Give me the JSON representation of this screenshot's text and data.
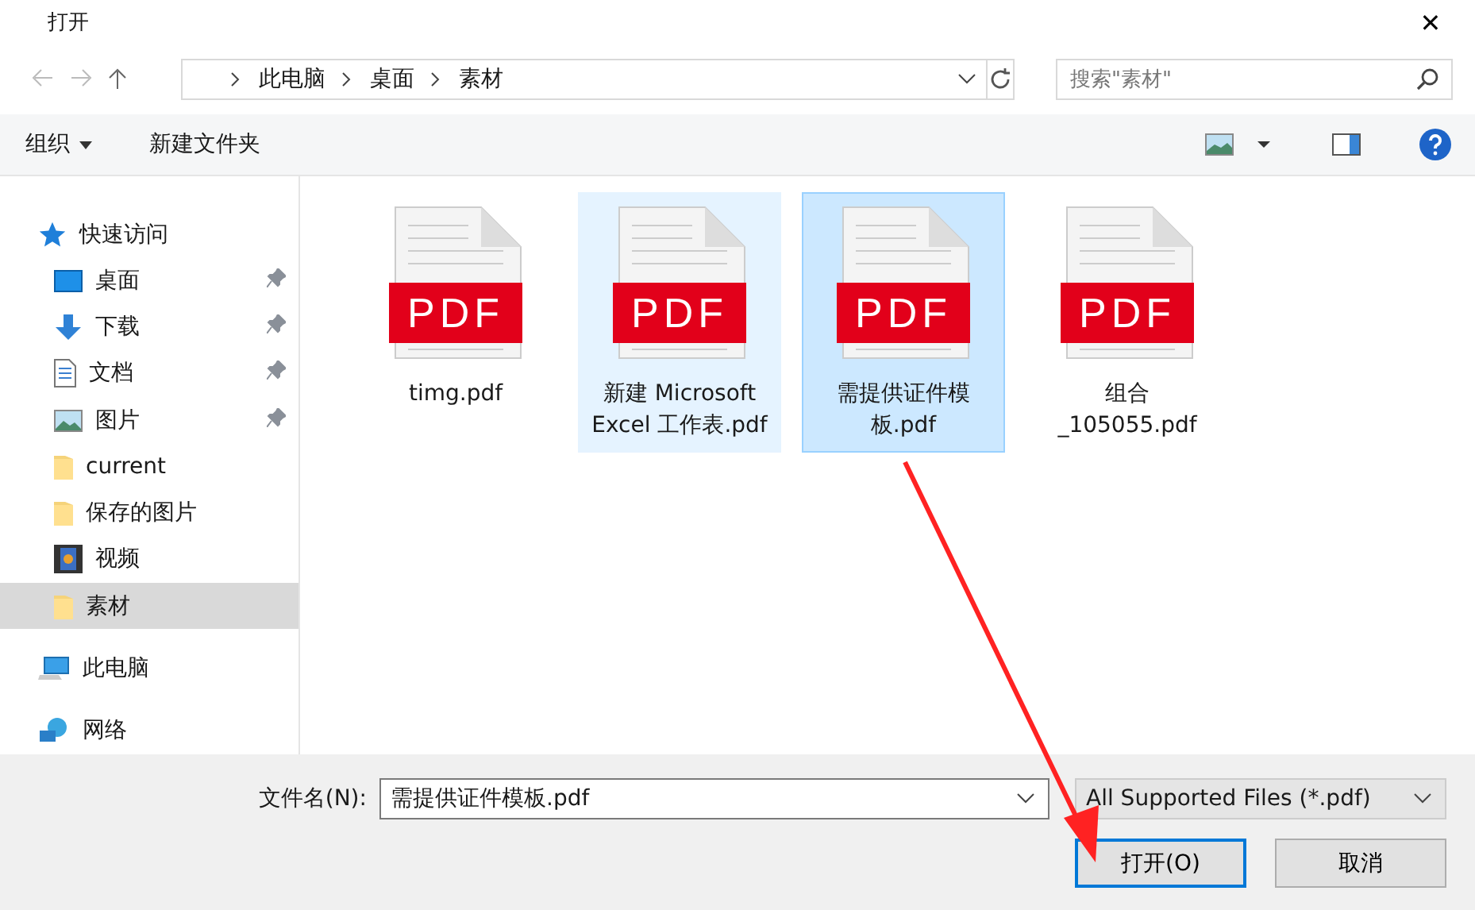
{
  "window": {
    "title": "打开",
    "close": "✕"
  },
  "address": {
    "segments": [
      "此电脑",
      "桌面",
      "素材"
    ],
    "search_placeholder": "搜索\"素材\""
  },
  "toolbar": {
    "organize": "组织",
    "new_folder": "新建文件夹"
  },
  "sidebar": {
    "items": [
      {
        "label": "快速访问",
        "kind": "star",
        "selected": false,
        "children": [
          {
            "label": "桌面",
            "kind": "desktop",
            "pinned": true,
            "selected": false
          },
          {
            "label": "下载",
            "kind": "download",
            "pinned": true,
            "selected": false
          },
          {
            "label": "文档",
            "kind": "document",
            "pinned": true,
            "selected": false
          },
          {
            "label": "图片",
            "kind": "pictures",
            "pinned": true,
            "selected": false
          },
          {
            "label": "current",
            "kind": "folder",
            "pinned": false,
            "selected": false
          },
          {
            "label": "保存的图片",
            "kind": "folder",
            "pinned": false,
            "selected": false
          },
          {
            "label": "视频",
            "kind": "video",
            "pinned": false,
            "selected": false
          },
          {
            "label": "素材",
            "kind": "folder",
            "pinned": false,
            "selected": true
          }
        ]
      },
      {
        "label": "此电脑",
        "kind": "computer",
        "selected": false
      },
      {
        "label": "网络",
        "kind": "network",
        "selected": false
      }
    ]
  },
  "files": [
    {
      "name": "timg.pdf",
      "badge": "PDF",
      "selected": false,
      "hovered": false
    },
    {
      "name": "新建 Microsoft Excel 工作表.pdf",
      "badge": "PDF",
      "selected": false,
      "hovered": true
    },
    {
      "name": "需提供证件模板.pdf",
      "badge": "PDF",
      "selected": true,
      "hovered": false
    },
    {
      "name": "组合_105055.pdf",
      "badge": "PDF",
      "selected": false,
      "hovered": false
    }
  ],
  "footer": {
    "filename_label": "文件名(N):",
    "filename": "需提供证件模板.pdf",
    "filter": "All Supported Files (*.pdf)",
    "open": "打开(O)",
    "cancel": "取消"
  }
}
